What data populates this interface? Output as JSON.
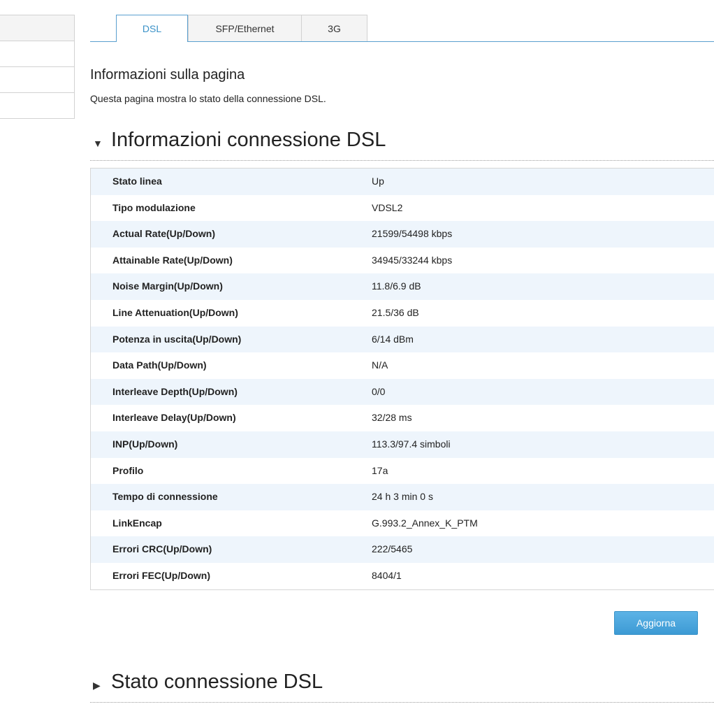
{
  "sidebar": {
    "items": [
      "",
      "",
      "",
      ""
    ]
  },
  "tabs": [
    {
      "label": "DSL",
      "active": true
    },
    {
      "label": "SFP/Ethernet",
      "active": false
    },
    {
      "label": "3G",
      "active": false
    }
  ],
  "page_info": {
    "title": "Informazioni sulla pagina",
    "description": "Questa pagina mostra lo stato della connessione DSL."
  },
  "section_dsl_info": {
    "title": "Informazioni connessione DSL",
    "expanded": true,
    "rows": [
      {
        "label": "Stato linea",
        "value": "Up"
      },
      {
        "label": "Tipo modulazione",
        "value": "VDSL2"
      },
      {
        "label": "Actual Rate(Up/Down)",
        "value": "21599/54498 kbps"
      },
      {
        "label": "Attainable Rate(Up/Down)",
        "value": "34945/33244 kbps"
      },
      {
        "label": "Noise Margin(Up/Down)",
        "value": "11.8/6.9 dB"
      },
      {
        "label": "Line Attenuation(Up/Down)",
        "value": "21.5/36 dB"
      },
      {
        "label": "Potenza in uscita(Up/Down)",
        "value": "6/14 dBm"
      },
      {
        "label": "Data Path(Up/Down)",
        "value": "N/A"
      },
      {
        "label": "Interleave Depth(Up/Down)",
        "value": "0/0"
      },
      {
        "label": "Interleave Delay(Up/Down)",
        "value": "32/28 ms"
      },
      {
        "label": "INP(Up/Down)",
        "value": "113.3/97.4 simboli"
      },
      {
        "label": "Profilo",
        "value": "17a"
      },
      {
        "label": "Tempo di connessione",
        "value": "24 h 3 min 0 s"
      },
      {
        "label": "LinkEncap",
        "value": "G.993.2_Annex_K_PTM"
      },
      {
        "label": "Errori CRC(Up/Down)",
        "value": "222/5465"
      },
      {
        "label": "Errori FEC(Up/Down)",
        "value": "8404/1"
      }
    ],
    "refresh_label": "Aggiorna"
  },
  "section_dsl_status": {
    "title": "Stato connessione DSL",
    "expanded": false
  },
  "colors": {
    "accent": "#3b92c8",
    "row_alt": "#eef5fc",
    "button": "#4aa6dc"
  },
  "icons": {
    "expanded": "triangle-down-icon",
    "collapsed": "triangle-right-icon"
  }
}
